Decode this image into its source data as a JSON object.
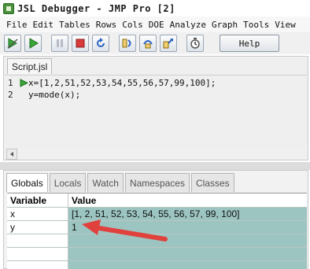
{
  "window": {
    "title": "JSL Debugger - JMP Pro [2]"
  },
  "menu": [
    "File",
    "Edit",
    "Tables",
    "Rows",
    "Cols",
    "DOE",
    "Analyze",
    "Graph",
    "Tools",
    "View"
  ],
  "toolbar": {
    "buttons": [
      "run-without-breakpoints-icon",
      "run-icon",
      "pause-icon",
      "stop-icon",
      "restart-icon",
      "step-into-icon",
      "step-over-icon",
      "step-out-icon",
      "timer-icon"
    ],
    "help_label": "Help"
  },
  "editor": {
    "tab_label": "Script.jsl",
    "lines": [
      {
        "number": "1",
        "code": "x=[1,2,51,52,53,54,55,56,57,99,100];",
        "current": true
      },
      {
        "number": "2",
        "code": "y=mode(x);",
        "current": false
      }
    ]
  },
  "variables_panel": {
    "tabs": [
      {
        "label": "Globals",
        "active": true
      },
      {
        "label": "Locals",
        "active": false
      },
      {
        "label": "Watch",
        "active": false
      },
      {
        "label": "Namespaces",
        "active": false
      },
      {
        "label": "Classes",
        "active": false
      }
    ],
    "columns": {
      "variable": "Variable",
      "value": "Value"
    },
    "rows": [
      {
        "variable": "x",
        "value": "[1, 2, 51, 52, 53, 54, 55, 56, 57, 99, 100]"
      },
      {
        "variable": "y",
        "value": "1"
      },
      {
        "variable": "",
        "value": ""
      },
      {
        "variable": "",
        "value": ""
      },
      {
        "variable": "",
        "value": ""
      }
    ]
  },
  "colors": {
    "value_cell": "#9cc5c1",
    "current_line_marker": "#3aa63a",
    "annotation_arrow": "#e0413d"
  }
}
